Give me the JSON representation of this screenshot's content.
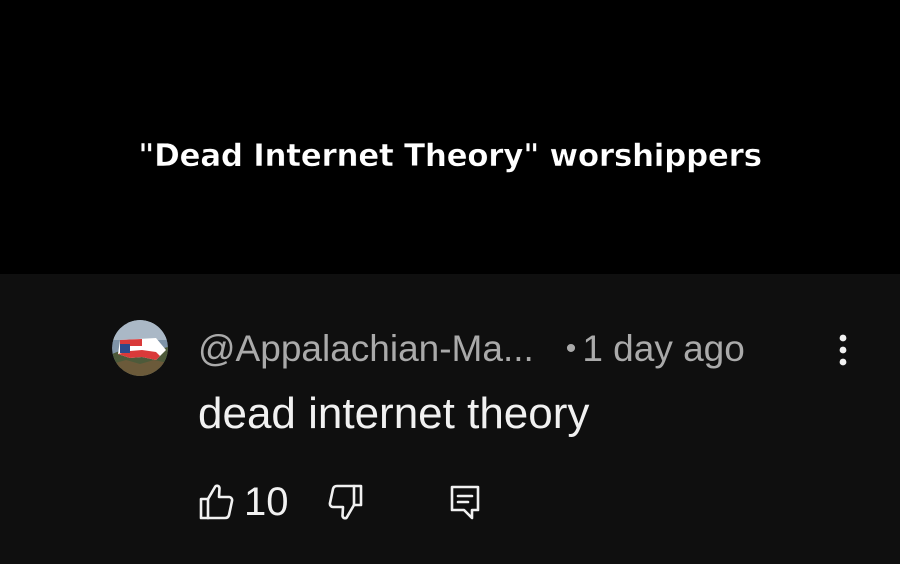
{
  "caption": {
    "text": "\"Dead Internet Theory\" worshippers"
  },
  "comment": {
    "author_handle": "@Appalachian-Ma...",
    "separator": "•",
    "timestamp": "1 day ago",
    "text": "dead internet theory",
    "like_count": "10"
  },
  "icons": {
    "avatar": "avatar-north-carolina-flag",
    "more": "more-vert-icon",
    "like": "thumbs-up-icon",
    "dislike": "thumbs-down-icon",
    "reply": "reply-comment-icon"
  },
  "colors": {
    "caption_bg": "#000000",
    "comment_bg": "#0f0f0f",
    "primary_text": "#f1f1f1",
    "secondary_text": "#aaaaaa"
  }
}
